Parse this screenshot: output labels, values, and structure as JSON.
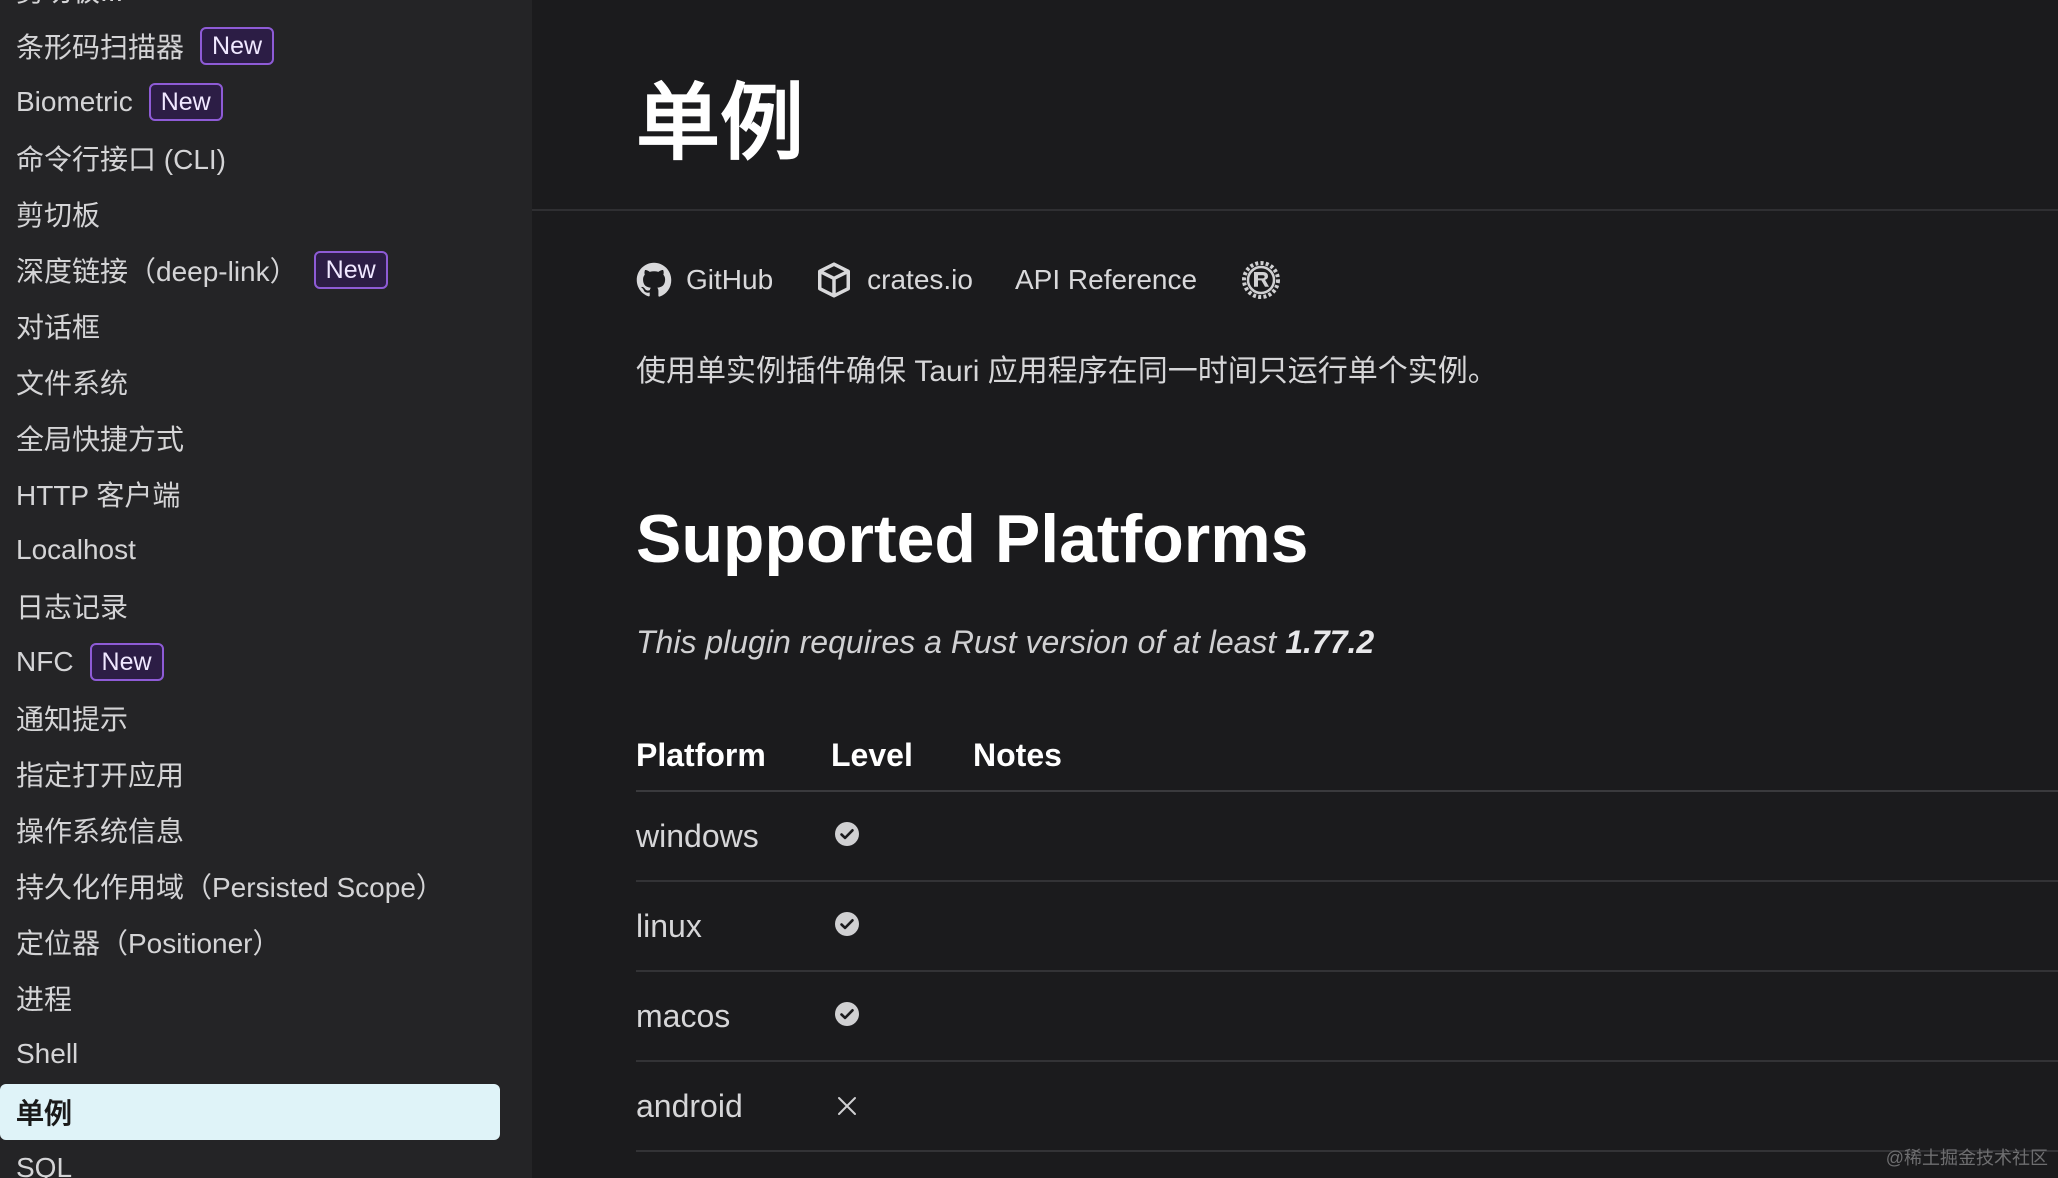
{
  "sidebar": {
    "items": [
      {
        "label": "剪切板...",
        "badge": ""
      },
      {
        "label": "条形码扫描器",
        "badge": "New"
      },
      {
        "label": "Biometric",
        "badge": "New"
      },
      {
        "label": "命令行接口 (CLI)",
        "badge": ""
      },
      {
        "label": "剪切板",
        "badge": ""
      },
      {
        "label": "深度链接（deep-link）",
        "badge": "New"
      },
      {
        "label": "对话框",
        "badge": ""
      },
      {
        "label": "文件系统",
        "badge": ""
      },
      {
        "label": "全局快捷方式",
        "badge": ""
      },
      {
        "label": "HTTP 客户端",
        "badge": ""
      },
      {
        "label": "Localhost",
        "badge": ""
      },
      {
        "label": "日志记录",
        "badge": ""
      },
      {
        "label": "NFC",
        "badge": "New"
      },
      {
        "label": "通知提示",
        "badge": ""
      },
      {
        "label": "指定打开应用",
        "badge": ""
      },
      {
        "label": "操作系统信息",
        "badge": ""
      },
      {
        "label": "持久化作用域（Persisted Scope）",
        "badge": ""
      },
      {
        "label": "定位器（Positioner）",
        "badge": ""
      },
      {
        "label": "进程",
        "badge": ""
      },
      {
        "label": "Shell",
        "badge": ""
      },
      {
        "label": "单例",
        "badge": "",
        "active": true
      },
      {
        "label": "SQL",
        "badge": ""
      }
    ]
  },
  "main": {
    "title": "单例",
    "links": {
      "github": "GitHub",
      "crates": "crates.io",
      "api": "API Reference"
    },
    "description": "使用单实例插件确保 Tauri 应用程序在同一时间只运行单个实例。",
    "section_heading": "Supported Platforms",
    "note_prefix": "This plugin requires a Rust version of at least ",
    "note_version": "1.77.2",
    "table": {
      "headers": {
        "platform": "Platform",
        "level": "Level",
        "notes": "Notes"
      },
      "rows": [
        {
          "platform": "windows",
          "level": "check-icon"
        },
        {
          "platform": "linux",
          "level": "check-icon"
        },
        {
          "platform": "macos",
          "level": "check-icon"
        },
        {
          "platform": "android",
          "level": "x-icon"
        }
      ]
    }
  },
  "watermark": "@稀土掘金技术社区",
  "colors": {
    "sidebar_bg": "#242426",
    "main_bg": "#1b1b1d",
    "active_bg": "#dff3f8",
    "badge_border": "#8e5bd6"
  }
}
